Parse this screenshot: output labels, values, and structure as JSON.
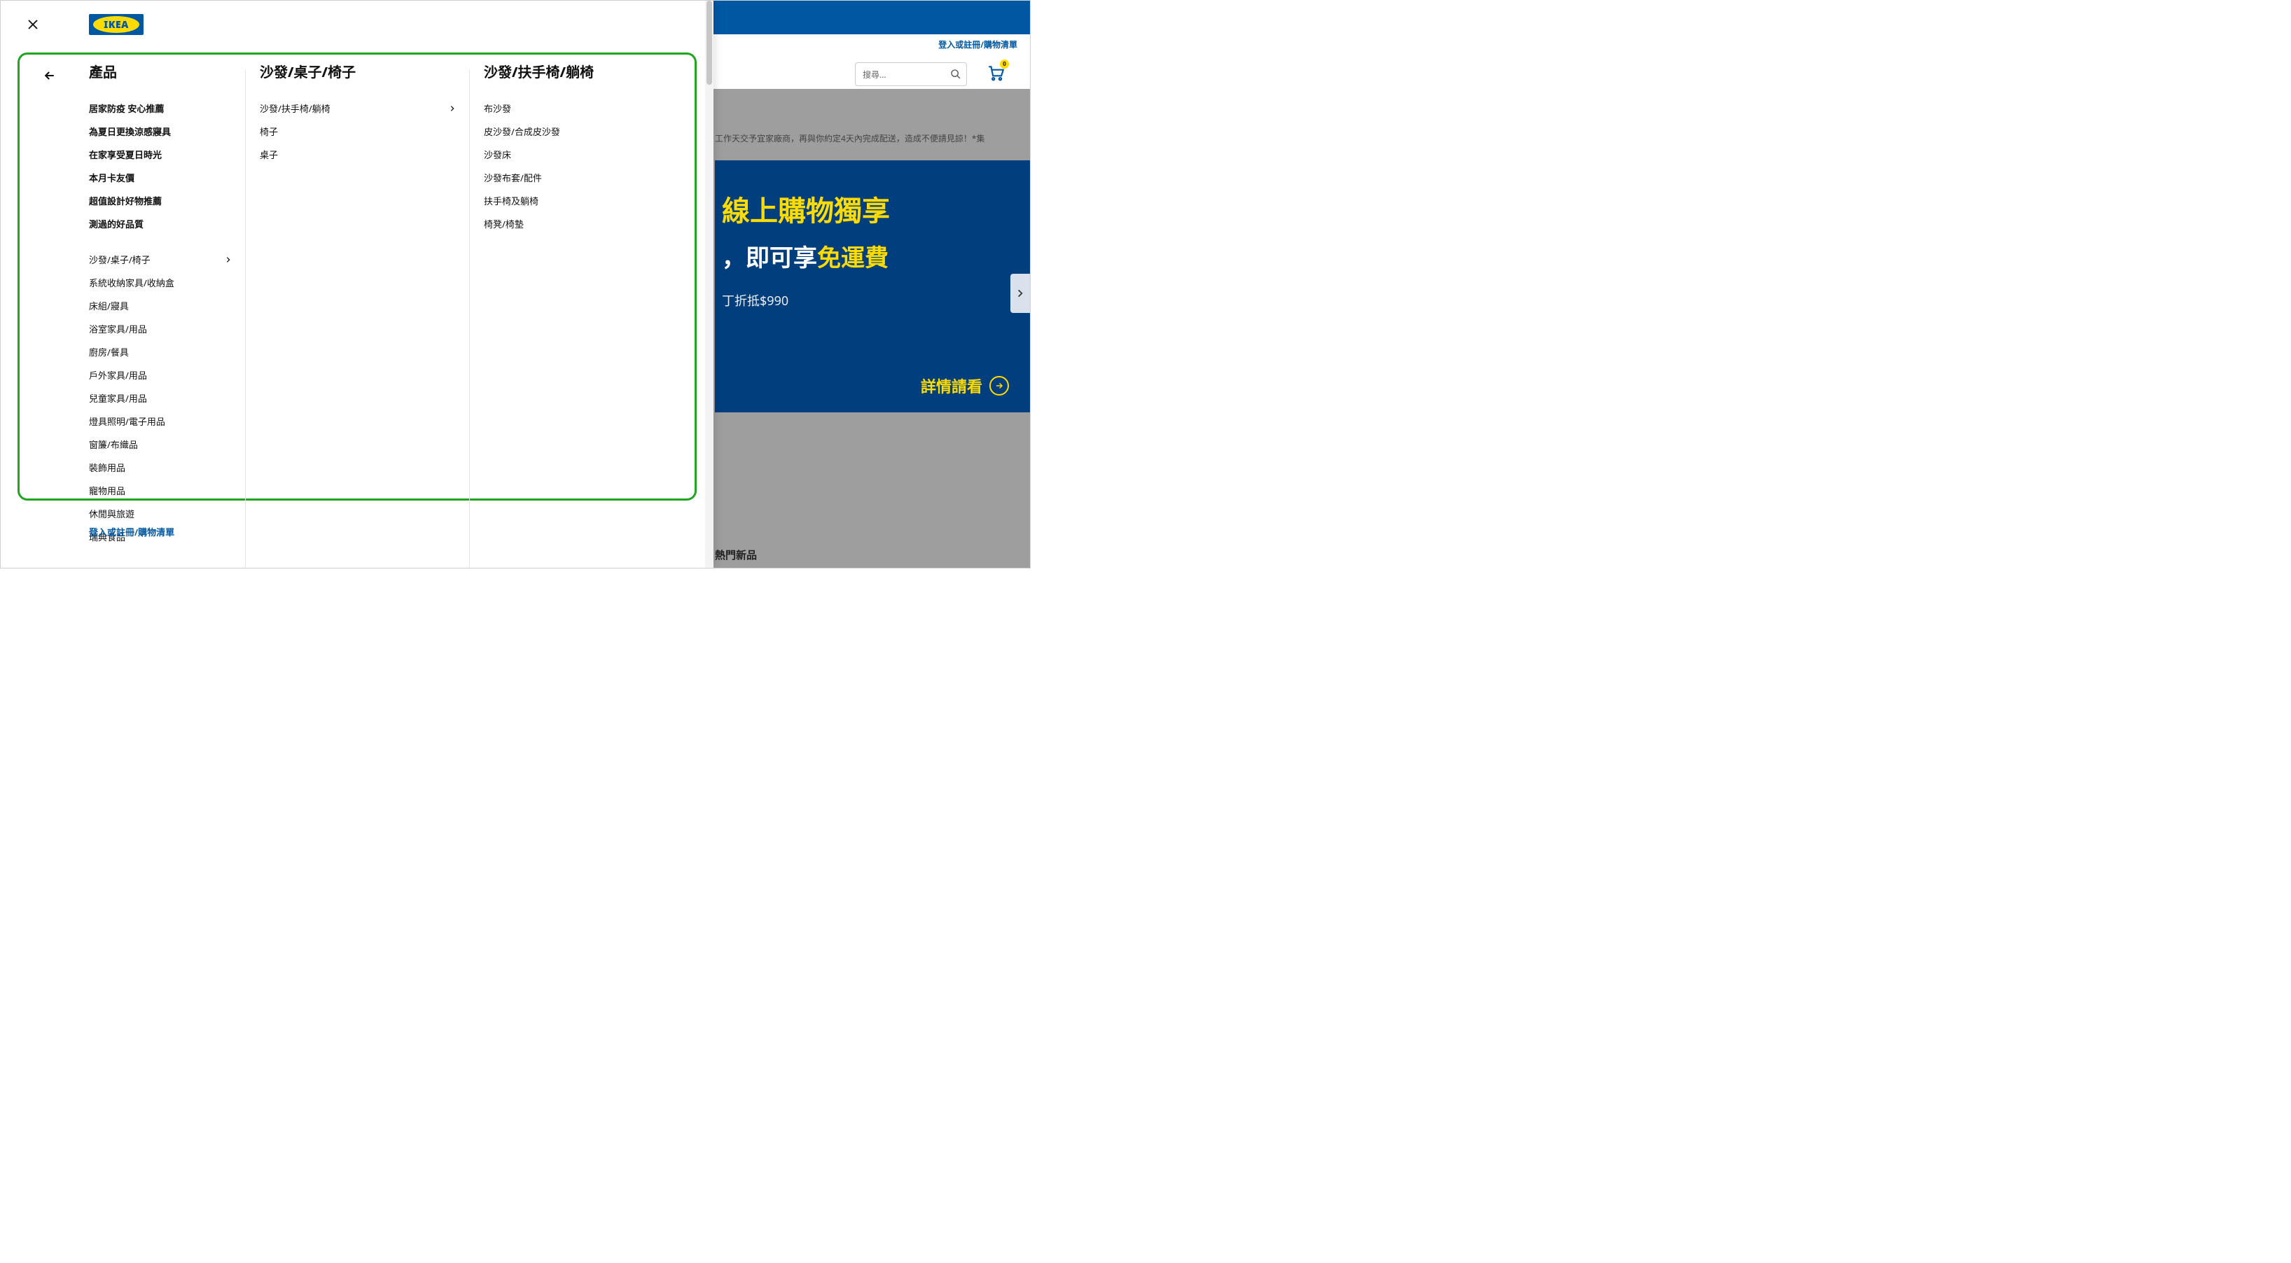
{
  "logo_text": "IKEA",
  "bg": {
    "login_link": "登入或註冊/購物清單",
    "search_placeholder": "搜尋...",
    "cart_badge": "0",
    "notice": "工作天交予宜家廠商，再與你約定4天內完成配送，造成不便請見諒！*集",
    "hero": {
      "line1": "線上購物獨享",
      "line2_prefix": "，即可享",
      "line2_em": "免運費",
      "line3": "丁折抵$990",
      "cta": "詳情請看"
    },
    "footer": "熱門新品"
  },
  "menu": {
    "col1": {
      "title": "產品",
      "featured": [
        "居家防疫 安心推薦",
        "為夏日更換涼感寢具",
        "在家享受夏日時光",
        "本月卡友價",
        "超值設計好物推薦",
        "測過的好品質"
      ],
      "items": [
        {
          "label": "沙發/桌子/椅子",
          "has_children": true
        },
        {
          "label": "系統收納家具/收納盒",
          "has_children": false
        },
        {
          "label": "床組/寢具",
          "has_children": false
        },
        {
          "label": "浴室家具/用品",
          "has_children": false
        },
        {
          "label": "廚房/餐具",
          "has_children": false
        },
        {
          "label": "戶外家具/用品",
          "has_children": false
        },
        {
          "label": "兒童家具/用品",
          "has_children": false
        },
        {
          "label": "燈具照明/電子用品",
          "has_children": false
        },
        {
          "label": "窗簾/布織品",
          "has_children": false
        },
        {
          "label": "裝飾用品",
          "has_children": false
        },
        {
          "label": "寵物用品",
          "has_children": false
        },
        {
          "label": "休閒與旅遊",
          "has_children": false
        },
        {
          "label": "瑞典食品",
          "has_children": false
        }
      ]
    },
    "col2": {
      "title": "沙發/桌子/椅子",
      "items": [
        {
          "label": "沙發/扶手椅/躺椅",
          "has_children": true
        },
        {
          "label": "椅子",
          "has_children": false
        },
        {
          "label": "桌子",
          "has_children": false
        }
      ]
    },
    "col3": {
      "title": "沙發/扶手椅/躺椅",
      "items": [
        {
          "label": "布沙發"
        },
        {
          "label": "皮沙發/合成皮沙發"
        },
        {
          "label": "沙發床"
        },
        {
          "label": "沙發布套/配件"
        },
        {
          "label": "扶手椅及躺椅"
        },
        {
          "label": "椅凳/椅墊"
        }
      ]
    },
    "bottom_link": "登入或註冊/購物清單"
  }
}
